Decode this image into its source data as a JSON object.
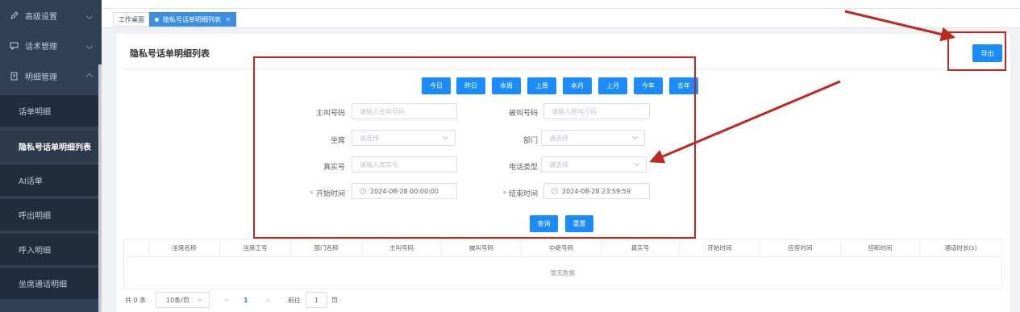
{
  "sidebar": {
    "items": [
      {
        "label": "高级设置",
        "icon": "edit-icon"
      },
      {
        "label": "话术管理",
        "icon": "chat-icon"
      },
      {
        "label": "明细管理",
        "icon": "document-icon"
      }
    ],
    "subitems": [
      "话单明细",
      "隐私号话单明细列表",
      "AI话单",
      "呼出明细",
      "呼入明细",
      "坐席通话明细"
    ]
  },
  "tabs": [
    "工作桌面",
    "隐私号话单明细列表"
  ],
  "page": {
    "title": "隐私号话单明细列表",
    "export_label": "导出"
  },
  "quick_dates": [
    "今日",
    "昨日",
    "本周",
    "上周",
    "本月",
    "上月",
    "今年",
    "去年"
  ],
  "form": {
    "caller": {
      "label": "主叫号码",
      "placeholder": "请输入主叫号码"
    },
    "callee": {
      "label": "被叫号码",
      "placeholder": "请输入被叫号码"
    },
    "agent": {
      "label": "坐席",
      "placeholder": "请选择"
    },
    "department": {
      "label": "部门",
      "placeholder": "请选择"
    },
    "real_number": {
      "label": "真实号",
      "placeholder": "请输入真实号"
    },
    "phone_type": {
      "label": "电话类型",
      "placeholder": "请选择"
    },
    "start_time": {
      "label": "开始时间",
      "value": "2024-08-28 00:00:00"
    },
    "end_time": {
      "label": "结束时间",
      "value": "2024-08-28 23:59:59"
    },
    "required_mark": "*",
    "query_label": "查询",
    "reset_label": "重置"
  },
  "table": {
    "columns": [
      "坐席名称",
      "坐席工号",
      "部门名称",
      "主叫号码",
      "被叫号码",
      "中继号码",
      "真实号",
      "开始时间",
      "应答时间",
      "挂断时间",
      "通话时长(s)"
    ],
    "empty_text": "暂无数据"
  },
  "pagination": {
    "total": "共 0 条",
    "page_size": "10条/页",
    "prev": "<",
    "current": "1",
    "next": ">",
    "goto_prefix": "前往",
    "goto_value": "1",
    "goto_suffix": "页"
  },
  "colors": {
    "primary": "#1a8cff",
    "sidebar_bg": "#304156",
    "annotation_red": "#c0281e"
  }
}
